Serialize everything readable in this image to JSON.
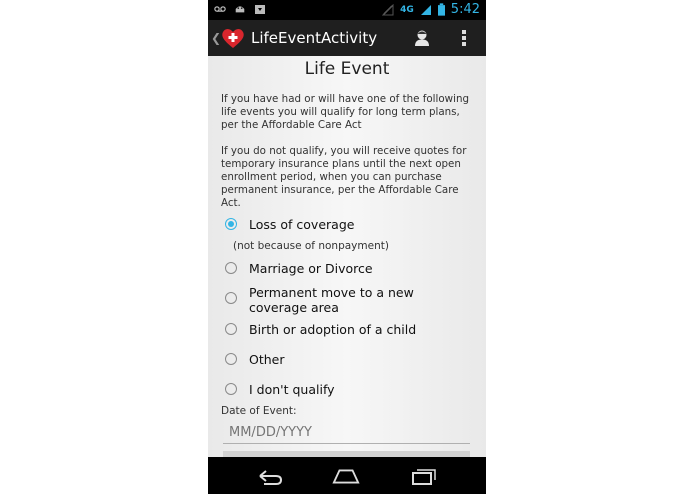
{
  "status_bar": {
    "time": "5:42",
    "network": "4G",
    "icons": [
      "voicemail-icon",
      "android-icon",
      "download-icon",
      "signal-off-icon",
      "signal-icon",
      "battery-icon"
    ],
    "accent_color": "#33b5e5"
  },
  "action_bar": {
    "title": "LifeEventActivity",
    "icons": [
      "up-chevron-icon",
      "app-heart-icon",
      "person-icon",
      "overflow-menu-icon"
    ]
  },
  "main": {
    "title": "Life Event",
    "intro_text": "If you have had or will have one of the following life events you will qualify for long term plans, per the Affordable Care Act",
    "disclaimer_text": "If you do not qualify, you will receive quotes for temporary insurance plans until the next open enrollment period, when you can purchase permanent insurance, per the Affordable Care Act.",
    "options": [
      {
        "label": "Loss of coverage",
        "checked": true
      },
      {
        "label": "Marriage or Divorce",
        "checked": false
      },
      {
        "label": "Permanent move to a new coverage area",
        "checked": false
      },
      {
        "label": "Birth or adoption of a child",
        "checked": false
      },
      {
        "label": "Other",
        "checked": false
      },
      {
        "label": "I don't qualify",
        "checked": false
      }
    ],
    "loss_note": "(not because of nonpayment)",
    "date_label": "Date of Event:",
    "date_placeholder": "MM/DD/YYYY"
  },
  "nav_bar": {
    "icons": [
      "back-icon",
      "home-icon",
      "recent-apps-icon"
    ]
  }
}
